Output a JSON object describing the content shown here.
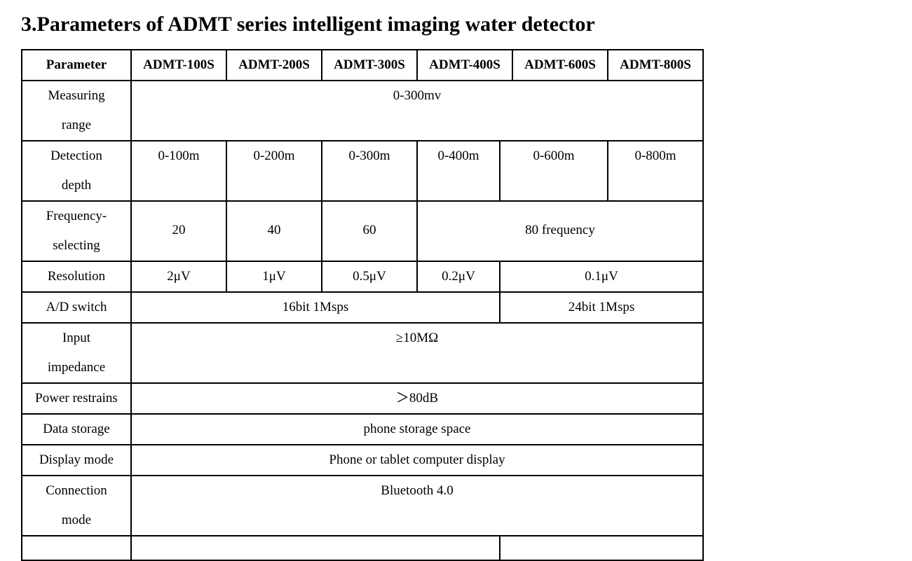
{
  "title": "3.Parameters of ADMT series intelligent imaging water detector",
  "table": {
    "header": [
      "Parameter",
      "ADMT-100S",
      "ADMT-200S",
      "ADMT-300S",
      "ADMT-400S",
      "ADMT-600S",
      "ADMT-800S"
    ],
    "measuring_range": {
      "label": [
        "Measuring",
        "range"
      ],
      "value": "0-300mv"
    },
    "detection_depth": {
      "label": [
        "Detection",
        "depth"
      ],
      "values": [
        "0-100m",
        "0-200m",
        "0-300m",
        "0-400m",
        "0-600m",
        "0-800m"
      ]
    },
    "frequency": {
      "label": [
        "Frequency-",
        "selecting"
      ],
      "values": [
        "20",
        "40",
        "60",
        "80 frequency"
      ]
    },
    "resolution": {
      "label": "Resolution",
      "values": [
        "2μV",
        "1μV",
        "0.5μV",
        "0.2μV",
        "0.1μV"
      ]
    },
    "ad_switch": {
      "label": "A/D switch",
      "values": [
        "16bit 1Msps",
        "24bit 1Msps"
      ]
    },
    "input_impedance": {
      "label": [
        "Input",
        "impedance"
      ],
      "value": "≥10MΩ"
    },
    "power_restrains": {
      "label": "Power restrains",
      "value": "＞80dB"
    },
    "data_storage": {
      "label": "Data storage",
      "value": "phone storage space"
    },
    "display_mode": {
      "label": "Display mode",
      "value": "Phone or tablet computer display"
    },
    "connection_mode": {
      "label": [
        "Connection",
        "mode"
      ],
      "value": "Bluetooth 4.0"
    }
  }
}
